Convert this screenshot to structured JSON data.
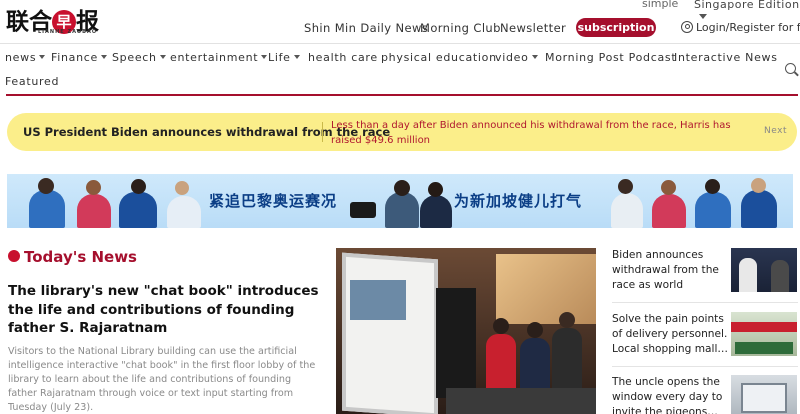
{
  "header": {
    "logo_cn": "联合早报",
    "logo_dot_char": "早",
    "logo_en": "LIANHE ZAOBAO",
    "lang_switch": "simple",
    "edition": "Singapore Edition",
    "links": [
      "Shin Min Daily News",
      "Morning Club",
      "Newsletter"
    ],
    "subscribe_label": "subscription",
    "login_label": "Login/Register for free"
  },
  "nav": {
    "items": [
      {
        "label": "news",
        "dropdown": true
      },
      {
        "label": "Finance",
        "dropdown": true
      },
      {
        "label": "Speech",
        "dropdown": true
      },
      {
        "label": "entertainment",
        "dropdown": true
      },
      {
        "label": "Life",
        "dropdown": true
      },
      {
        "label": "health care",
        "dropdown": false
      },
      {
        "label": "physical education",
        "dropdown": false
      },
      {
        "label": "video",
        "dropdown": true
      },
      {
        "label": "Morning Post Podcast",
        "dropdown": false
      },
      {
        "label": "Interactive News",
        "dropdown": false
      }
    ],
    "featured_label": "Featured"
  },
  "ticker": {
    "headline": "US President Biden announces withdrawal from the race",
    "detail": "Less than a day after Biden announced his withdrawal from the race, Harris has raised $49.6 million",
    "next_label": "Next"
  },
  "banner": {
    "text_left": "紧追巴黎奥运赛况",
    "text_right": "为新加坡健儿打气"
  },
  "main": {
    "section_title": "Today's News",
    "lead_title": "The library's new \"chat book\" introduces the life and contributions of founding father S. Rajaratnam",
    "lead_summary": "Visitors to the National Library building can use the artificial intelligence interactive \"chat book\" in the first floor lobby of the library to learn about the life and contributions of founding father Rajaratnam through voice or text input starting from Tuesday (July 23)."
  },
  "sidebar": {
    "items": [
      {
        "title": "Biden announces withdrawal from the race as world leader…"
      },
      {
        "title": "Solve the pain points of delivery personnel. Local shopping mall…"
      },
      {
        "title": "The uncle opens the window every day to invite the pigeons…"
      }
    ]
  },
  "colors": {
    "brand_red": "#a50f2d",
    "ticker_bg": "#fbee8a",
    "ticker_text": "#b0182f",
    "banner_text": "#0b3e86"
  }
}
